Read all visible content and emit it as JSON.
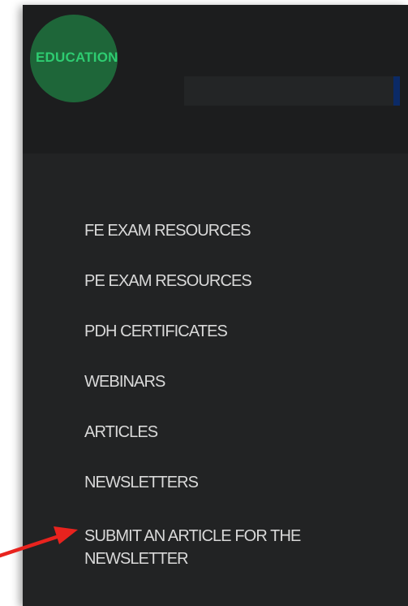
{
  "header": {
    "brand_label": "EDUCATION"
  },
  "menu": {
    "items": [
      {
        "label": "FE EXAM RESOURCES"
      },
      {
        "label": "PE EXAM RESOURCES"
      },
      {
        "label": "PDH CERTIFICATES"
      },
      {
        "label": "WEBINARS"
      },
      {
        "label": "ARTICLES"
      },
      {
        "label": "NEWSLETTERS"
      },
      {
        "label_line1": "SUBMIT AN ARTICLE FOR THE",
        "label_line2": "NEWSLETTER"
      }
    ]
  },
  "annotation": {
    "arrow_color": "#e8231e",
    "highlight_color": "#1f6a3b",
    "brand_color": "#2ecc71"
  }
}
